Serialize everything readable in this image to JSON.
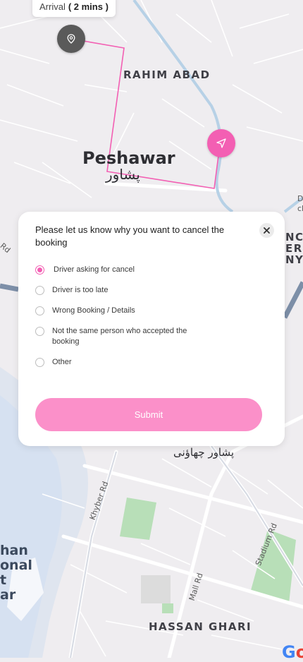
{
  "arrival": {
    "label": "Arrival",
    "time": "( 2 mins )"
  },
  "map": {
    "labels": {
      "rahim_abad": "RAHIM ABAD",
      "peshawar": "Peshawar",
      "peshawar_urdu": "پشاور",
      "cantonment_urdu": "پشاور چھاؤنی",
      "hassan_ghari": "HASSAN GHARI",
      "khyber_rd": "Khyber Rd",
      "mall_rd": "Mall Rd",
      "stadium_rd": "Stadium Rd",
      "rd_left": "Rd",
      "right_partial": "NCE\nERS\nNY",
      "left_partial": "han\nonal\nt\nar",
      "d_partial": "D\ncl"
    },
    "route_color": "#f35fb3"
  },
  "modal": {
    "title": "Please let us know why you want to cancel the booking",
    "options": [
      {
        "label": "Driver asking for cancel",
        "selected": true
      },
      {
        "label": "Driver is too late",
        "selected": false
      },
      {
        "label": "Wrong Booking / Details",
        "selected": false
      },
      {
        "label": "Not the same person who accepted the booking",
        "selected": false
      },
      {
        "label": "Other",
        "selected": false
      }
    ],
    "submit_label": "Submit"
  },
  "colors": {
    "accent": "#f35fb3",
    "submit_bg": "#fb90c9",
    "map_bg": "#efedf0"
  },
  "icons": {
    "close": "close-icon",
    "pickup": "location-pin-icon",
    "driver": "navigation-arrow-icon"
  },
  "attribution": "Google"
}
